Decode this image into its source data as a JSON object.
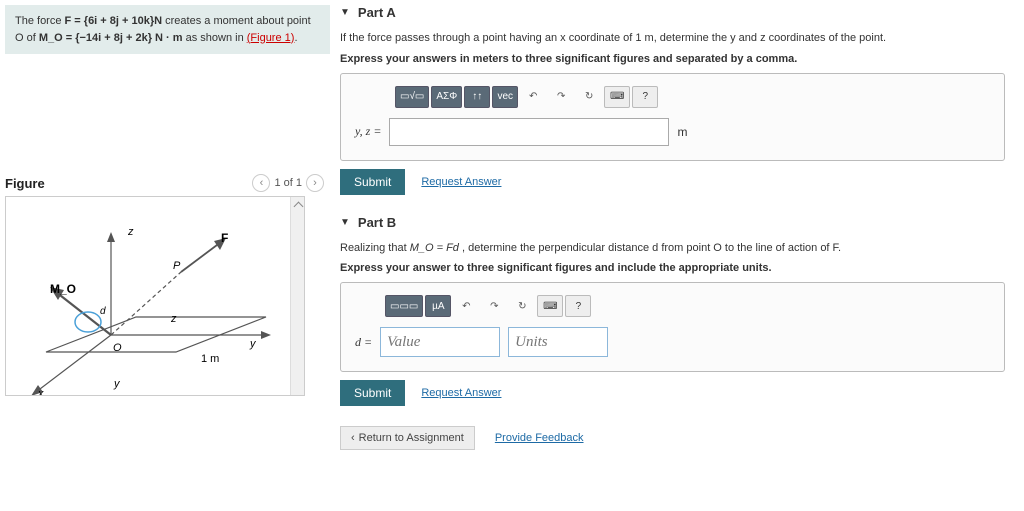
{
  "problem": {
    "sentence_pre": "The force ",
    "force_expr": "F = {6i + 8j + 10k}N",
    "sentence_mid": " creates a moment about point O of ",
    "moment_expr": "M_O = {−14i + 8j + 2k} N · m",
    "sentence_post": " as shown in ",
    "figure_link": "(Figure 1)",
    "sentence_end": "."
  },
  "figure": {
    "title": "Figure",
    "pager": "1 of 1",
    "labels": {
      "z": "z",
      "y": "y",
      "x": "x",
      "P": "P",
      "F": "F",
      "O": "O",
      "d": "d",
      "Mo": "M_O",
      "len": "1 m"
    }
  },
  "partA": {
    "heading": "Part A",
    "desc": "If the force passes through a point having an x coordinate of 1 m, determine the y and z coordinates of the point.",
    "instruction": "Express your answers in meters to three significant figures and separated by a comma.",
    "toolbar": {
      "t1": "▭√▭",
      "t2": "ΑΣΦ",
      "t3": "↑↑",
      "t4": "vec",
      "undo": "↶",
      "redo": "↷",
      "reset": "↻",
      "kbd": "⌨",
      "help": "?"
    },
    "label": "y, z =",
    "unit": "m",
    "submit": "Submit",
    "request": "Request Answer"
  },
  "partB": {
    "heading": "Part B",
    "desc_pre": "Realizing that ",
    "desc_expr": "M_O = Fd",
    "desc_post": ", determine the perpendicular distance d from point O to the line of action of F.",
    "instruction": "Express your answer to three significant figures and include the appropriate units.",
    "toolbar": {
      "t1": "▭▭▭",
      "t2": "µA",
      "undo": "↶",
      "redo": "↷",
      "reset": "↻",
      "kbd": "⌨",
      "help": "?"
    },
    "label": "d =",
    "value_ph": "Value",
    "units_ph": "Units",
    "submit": "Submit",
    "request": "Request Answer"
  },
  "footer": {
    "return": "Return to Assignment",
    "feedback": "Provide Feedback"
  }
}
